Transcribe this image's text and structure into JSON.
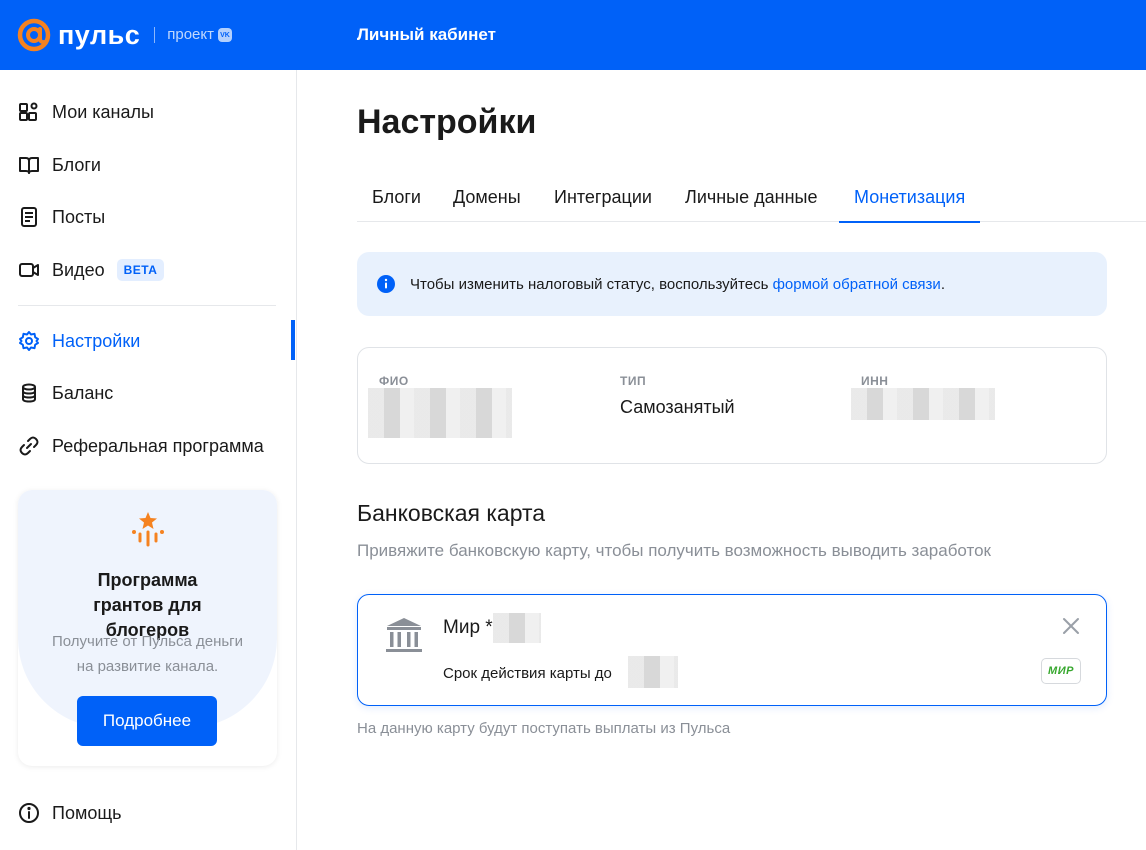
{
  "header": {
    "logo_word": "пульс",
    "logo_project": "проект",
    "logo_vk": "VK",
    "title": "Личный кабинет"
  },
  "sidebar": {
    "items": [
      {
        "label": "Мои каналы",
        "icon": "channels-icon"
      },
      {
        "label": "Блоги",
        "icon": "book-icon"
      },
      {
        "label": "Посты",
        "icon": "document-icon"
      },
      {
        "label": "Видео",
        "icon": "video-icon",
        "badge": "BETA"
      },
      {
        "label": "Настройки",
        "icon": "gear-icon",
        "active": true
      },
      {
        "label": "Баланс",
        "icon": "coins-icon"
      },
      {
        "label": "Реферальная программа",
        "icon": "link-icon"
      }
    ],
    "promo": {
      "title": "Программа грантов для блогеров",
      "text": "Получите от Пульса деньги на развитие канала.",
      "button": "Подробнее"
    },
    "help": {
      "label": "Помощь",
      "icon": "info-icon"
    }
  },
  "main": {
    "title": "Настройки",
    "tabs": [
      {
        "label": "Блоги"
      },
      {
        "label": "Домены"
      },
      {
        "label": "Интеграции"
      },
      {
        "label": "Личные данные"
      },
      {
        "label": "Монетизация",
        "active": true
      }
    ],
    "notice": {
      "text": "Чтобы изменить налоговый статус, воспользуйтесь ",
      "link": "формой обратной связи",
      "end": "."
    },
    "personal": {
      "fio_label": "ФИО",
      "type_label": "ТИП",
      "type_value": "Самозанятый",
      "inn_label": "ИНН"
    },
    "bank": {
      "title": "Банковская карта",
      "subtitle": "Привяжите банковскую карту, чтобы получить возможность выводить заработок",
      "card_name": "Мир *",
      "card_expiry": "Срок действия карты до",
      "payment_system": "МИР",
      "note": "На данную карту будут поступать выплаты из Пульса"
    }
  },
  "colors": {
    "accent": "#0061f8",
    "promo_icon": "#f58220"
  }
}
